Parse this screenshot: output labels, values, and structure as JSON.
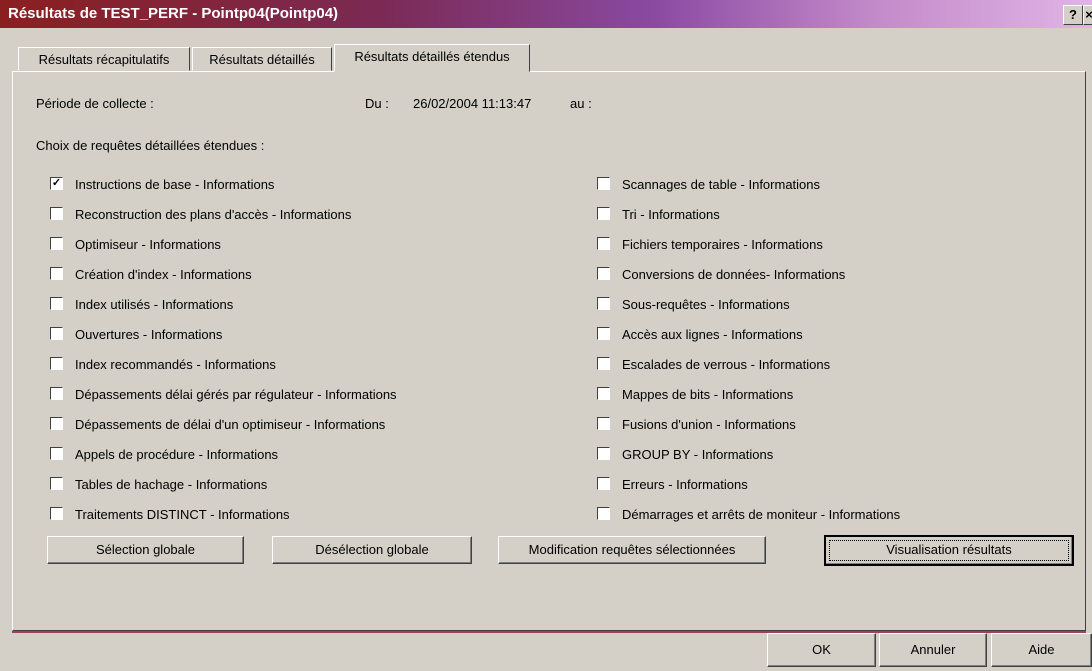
{
  "window": {
    "title": "Résultats de TEST_PERF - Pointp04(Pointp04)",
    "help_button": "?",
    "close_button": "×"
  },
  "tabs": [
    {
      "label": "Résultats récapitulatifs",
      "active": false
    },
    {
      "label": "Résultats détaillés",
      "active": false
    },
    {
      "label": "Résultats détaillés étendus",
      "active": true
    }
  ],
  "period": {
    "label": "Période de collecte :",
    "from_label": "Du :",
    "from_value": "26/02/2004 11:13:47",
    "to_label": "au :"
  },
  "choices_label": "Choix de requêtes détaillées étendues :",
  "left_options": [
    {
      "label": "Instructions de base - Informations",
      "checked": true
    },
    {
      "label": "Reconstruction des plans d'accès - Informations",
      "checked": false
    },
    {
      "label": "Optimiseur - Informations",
      "checked": false
    },
    {
      "label": "Création d'index - Informations",
      "checked": false
    },
    {
      "label": "Index utilisés - Informations",
      "checked": false
    },
    {
      "label": "Ouvertures - Informations",
      "checked": false
    },
    {
      "label": "Index recommandés - Informations",
      "checked": false
    },
    {
      "label": "Dépassements délai gérés par régulateur - Informations",
      "checked": false
    },
    {
      "label": "Dépassements de délai d'un optimiseur - Informations",
      "checked": false
    },
    {
      "label": "Appels de procédure - Informations",
      "checked": false
    },
    {
      "label": "Tables de hachage - Informations",
      "checked": false
    },
    {
      "label": "Traitements DISTINCT - Informations",
      "checked": false
    }
  ],
  "right_options": [
    {
      "label": "Scannages de table - Informations",
      "checked": false
    },
    {
      "label": "Tri - Informations",
      "checked": false
    },
    {
      "label": "Fichiers temporaires - Informations",
      "checked": false
    },
    {
      "label": "Conversions de données- Informations",
      "checked": false
    },
    {
      "label": "Sous-requêtes - Informations",
      "checked": false
    },
    {
      "label": "Accès aux lignes - Informations",
      "checked": false
    },
    {
      "label": "Escalades de verrous - Informations",
      "checked": false
    },
    {
      "label": "Mappes de bits - Informations",
      "checked": false
    },
    {
      "label": "Fusions d'union - Informations",
      "checked": false
    },
    {
      "label": "GROUP BY - Informations",
      "checked": false
    },
    {
      "label": "Erreurs - Informations",
      "checked": false
    },
    {
      "label": "Démarrages et arrêts de moniteur - Informations",
      "checked": false
    }
  ],
  "action_buttons": {
    "select_all": "Sélection globale",
    "deselect_all": "Désélection globale",
    "modify": "Modification requêtes sélectionnées",
    "view": "Visualisation résultats"
  },
  "dialog_buttons": {
    "ok": "OK",
    "cancel": "Annuler",
    "help": "Aide"
  }
}
